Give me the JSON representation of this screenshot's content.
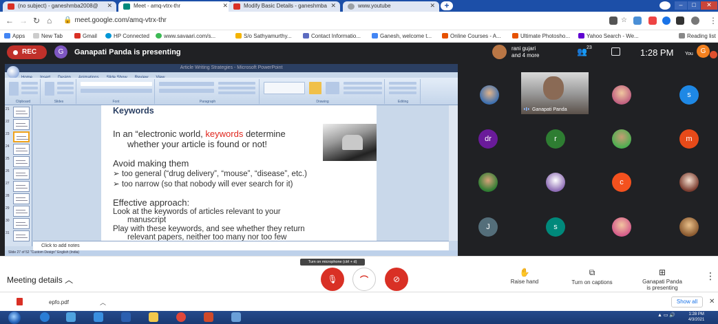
{
  "browser": {
    "tabs": [
      {
        "label": "(no subject) - ganeshmba2008@",
        "active": false
      },
      {
        "label": "Meet - amq-vtrx-thr",
        "active": true
      },
      {
        "label": "Modify Basic Details - ganeshmba",
        "active": false
      },
      {
        "label": "www.youtube",
        "active": false
      }
    ],
    "url": "meet.google.com/amq-vtrx-thr",
    "bookmarks": [
      "Apps",
      "New Tab",
      "Gmail",
      "HP Connected",
      "www.savaari.com/s...",
      "S/o Sathyamurthy...",
      "Contact Informatio...",
      "Ganesh, welcome t...",
      "Online Courses - A...",
      "Ultimate Photosho...",
      "Yahoo Search - We...",
      "Reading list"
    ]
  },
  "meet": {
    "rec_label": "REC",
    "presenter_initial": "G",
    "presenter_text": "Ganapati Panda is presenting",
    "viewer_name": "rani gujari",
    "viewer_more": "and 4 more",
    "participant_count": "23",
    "time": "1:28 PM",
    "you_label": "You",
    "you_initial": "G",
    "speaker_name": "Ganapati Panda",
    "tiles": [
      "s",
      "dr",
      "r",
      "m",
      "c",
      "J",
      "s"
    ]
  },
  "ppt": {
    "window_title": "Article Writing Strategies - Microsoft PowerPoint",
    "ribbon_tabs": [
      "Home",
      "Insert",
      "Design",
      "Animations",
      "Slide Show",
      "Review",
      "View"
    ],
    "ribbon_groups": [
      "Clipboard",
      "Slides",
      "Font",
      "Paragraph",
      "Drawing",
      "Editing"
    ],
    "slide_title": "Keywords",
    "lines": {
      "l1_a": "In an “electronic world, ",
      "l1_red": "keywords",
      "l1_b": " determine",
      "l2": "whether your article is found or not!",
      "l3": "Avoid making them",
      "l4": "➢  too general (“drug delivery”, “mouse”, “disease”, etc.)",
      "l5": "➢  too narrow (so that nobody will ever search for it)",
      "l6": "Effective approach:",
      "l7": "Look at the keywords of articles relevant to your",
      "l8": "manuscript",
      "l9": "Play with these keywords, and see whether they return",
      "l10": "relevant papers, neither too many nor too few"
    },
    "notes_placeholder": "Click to add notes",
    "status": "Slide 27 of 52    \"Custom Design\"    English (India)"
  },
  "controls": {
    "meeting_details": "Meeting details",
    "tooltip": "Turn on microphone (ctrl + d)",
    "raise_hand": "Raise hand",
    "captions": "Turn on captions",
    "presenting_line1": "Ganapati Panda",
    "presenting_line2": "is presenting"
  },
  "downloads": {
    "file": "epfo.pdf",
    "show_all": "Show all"
  },
  "taskbar": {
    "time": "1:28 PM",
    "date": "4/3/2021"
  },
  "colors": {
    "meet_dark": "#202124",
    "rec_red": "#c0302a",
    "end_call_red": "#d93025",
    "keyword_red": "#e0261d",
    "slide_title_blue": "#2a3f63"
  }
}
